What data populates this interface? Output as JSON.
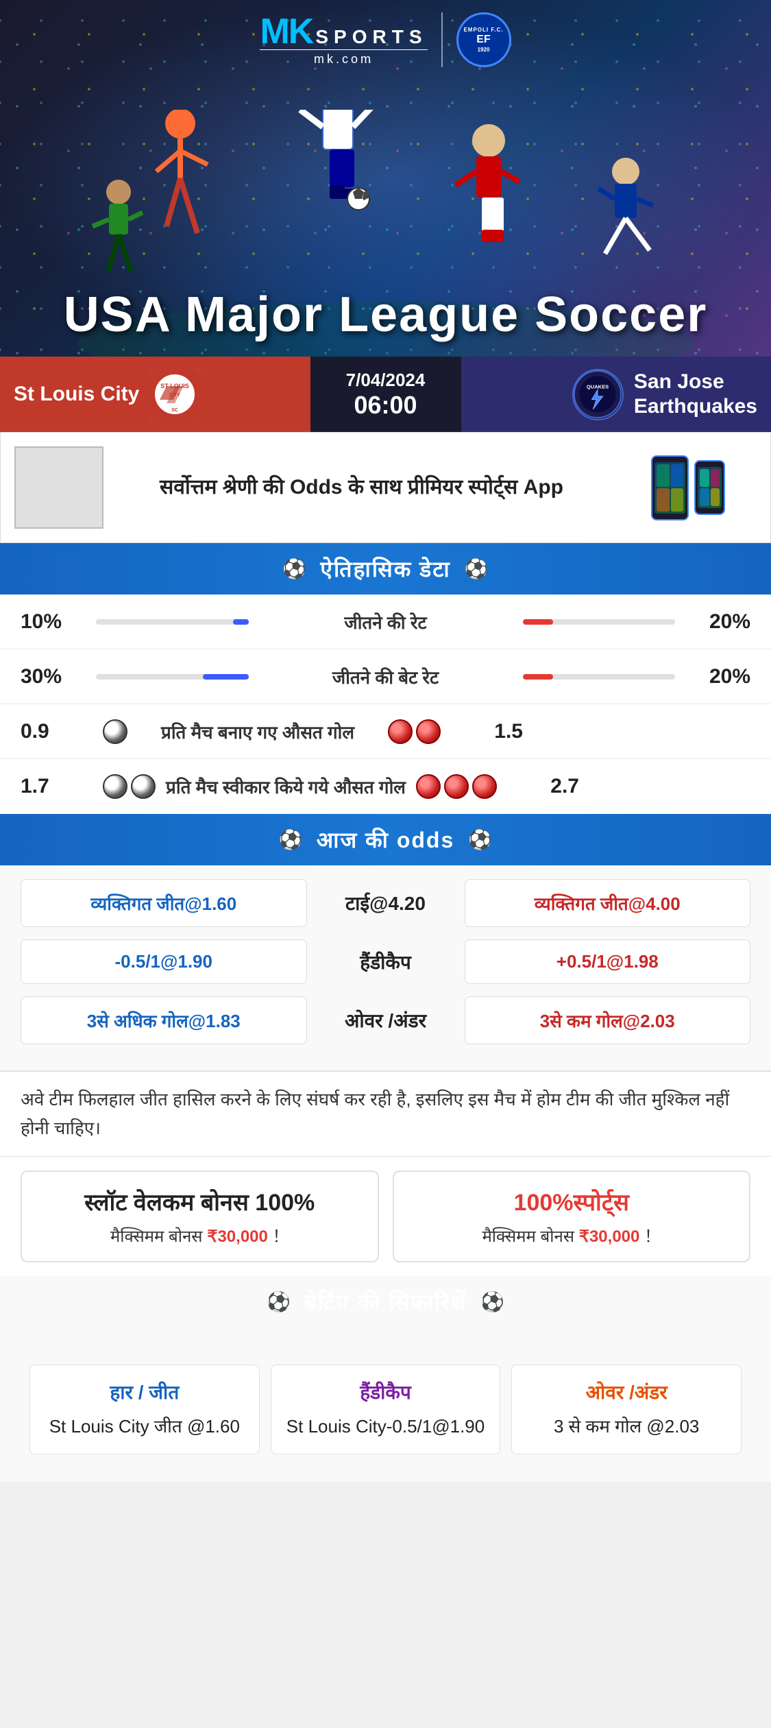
{
  "brand": {
    "mk": "MK",
    "sports": "SPORTS",
    "mkcom": "mk.com",
    "empoli": "EMPOLI F.C.\n1920"
  },
  "hero": {
    "title": "USA Major League Soccer"
  },
  "match": {
    "home_team": "St Louis City",
    "away_team": "San Jose Earthquakes",
    "away_team_line1": "San Jose",
    "away_team_line2": "Earthquakes",
    "date": "7/04/2024",
    "time": "06:00",
    "quakes_label": "QUAKES"
  },
  "promo": {
    "text": "सर्वोत्तम श्रेणी की Odds के साथ प्रीमियर स्पोर्ट्स App"
  },
  "historical": {
    "section_title": "ऐतिहासिक डेटा",
    "rows": [
      {
        "left_val": "10%",
        "label": "जीतने की रेट",
        "right_val": "20%",
        "left_pct": 10,
        "right_pct": 20
      },
      {
        "left_val": "30%",
        "label": "जीतने की बेट रेट",
        "right_val": "20%",
        "left_pct": 30,
        "right_pct": 20
      },
      {
        "left_val": "0.9",
        "label": "प्रति मैच बनाए गए औसत गोल",
        "right_val": "1.5",
        "left_balls": 1,
        "right_balls": 2
      },
      {
        "left_val": "1.7",
        "label": "प्रति मैच स्वीकार किये गये औसत गोल",
        "right_val": "2.7",
        "left_balls": 2,
        "right_balls": 3
      }
    ]
  },
  "odds": {
    "section_title": "आज की odds",
    "rows": [
      {
        "left": "व्यक्तिगत जीत@1.60",
        "center": "टाई@4.20",
        "right": "व्यक्तिगत जीत@4.00",
        "left_color": "blue",
        "center_color": "black",
        "right_color": "red"
      },
      {
        "left": "-0.5/1@1.90",
        "center": "हैंडीकैप",
        "right": "+0.5/1@1.98",
        "left_color": "blue",
        "center_color": "black",
        "right_color": "red"
      },
      {
        "left": "3से अधिक गोल@1.83",
        "center": "ओवर /अंडर",
        "right": "3से कम गोल@2.03",
        "left_color": "blue",
        "center_color": "black",
        "right_color": "red"
      }
    ]
  },
  "note": "अवे टीम फिलहाल जीत हासिल करने के लिए संघर्ष कर रही है, इसलिए इस मैच में होम टीम की जीत मुश्किल नहीं होनी चाहिए।",
  "bonus": {
    "card1_title": "स्लॉट वेलकम बोनस 100%",
    "card1_sub": "मैक्सिमम बोनस ₹30,000 ！",
    "card2_title": "100%स्पोर्ट्स",
    "card2_sub": "मैक्सिमम बोनस  ₹30,000 ！"
  },
  "betting": {
    "section_title": "बेटिंग की सिफारिशें",
    "cards": [
      {
        "title": "हार / जीत",
        "value": "St Louis City जीत @1.60",
        "color": "blue"
      },
      {
        "title": "हैंडीकैप",
        "value": "St Louis City-0.5/1@1.90",
        "color": "purple"
      },
      {
        "title": "ओवर /अंडर",
        "value": "3 से कम गोल @2.03",
        "color": "orange"
      }
    ]
  }
}
